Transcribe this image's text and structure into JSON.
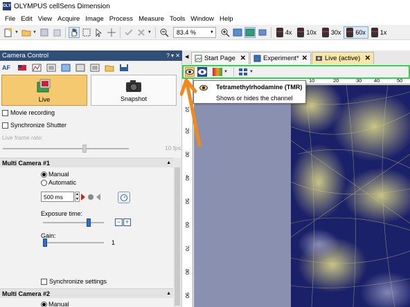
{
  "window": {
    "title": "OLYMPUS cellSens Dimension",
    "logo_text": "OLY"
  },
  "menu": [
    "File",
    "Edit",
    "View",
    "Acquire",
    "Image",
    "Process",
    "Measure",
    "Tools",
    "Window",
    "Help"
  ],
  "toolbar": {
    "zoom_value": "83.4 %",
    "objectives": [
      {
        "label": "4x",
        "active": false
      },
      {
        "label": "10x",
        "active": false
      },
      {
        "label": "30x",
        "active": false
      },
      {
        "label": "60x",
        "active": true
      },
      {
        "label": "1x",
        "active": false
      }
    ]
  },
  "panel": {
    "title": "Camera Control",
    "header_icons": "? ▾ ✕",
    "af_label": "AF",
    "live_label": "Live",
    "snapshot_label": "Snapshot",
    "movie_recording": "Movie recording",
    "synchronize_shutter": "Synchronize Shutter",
    "live_frame_rate_label": "Live frame rate:",
    "live_frame_rate_value": "10 fps",
    "multi_camera_1": "Multi Camera #1",
    "manual": "Manual",
    "automatic": "Automatic",
    "exposure_value": "500 ms",
    "exposure_time_label": "Exposure time:",
    "gain_label": "Gain:",
    "gain_value": "1",
    "synchronize_settings": "Synchronize settings",
    "multi_camera_2": "Multi Camera #2",
    "manual_2": "Manual",
    "collapse_icon": "▲"
  },
  "tabs": [
    {
      "label": "Start Page"
    },
    {
      "label": "Experiment*"
    },
    {
      "label": "Live (active)"
    }
  ],
  "ruler": {
    "top": [
      "10",
      "20",
      "30",
      "40",
      "50"
    ],
    "left": [
      "10",
      "20",
      "30",
      "40",
      "50",
      "60",
      "70",
      "80",
      "90"
    ]
  },
  "tooltip": {
    "title": "Tetramethylrhodamine (TMR)",
    "description": "Shows or hides the channel"
  },
  "colors": {
    "highlight_green": "#2bd64a",
    "arrow_orange": "#f08a1c",
    "panel_header": "#2f4f78",
    "live_button": "#f5c96f"
  }
}
